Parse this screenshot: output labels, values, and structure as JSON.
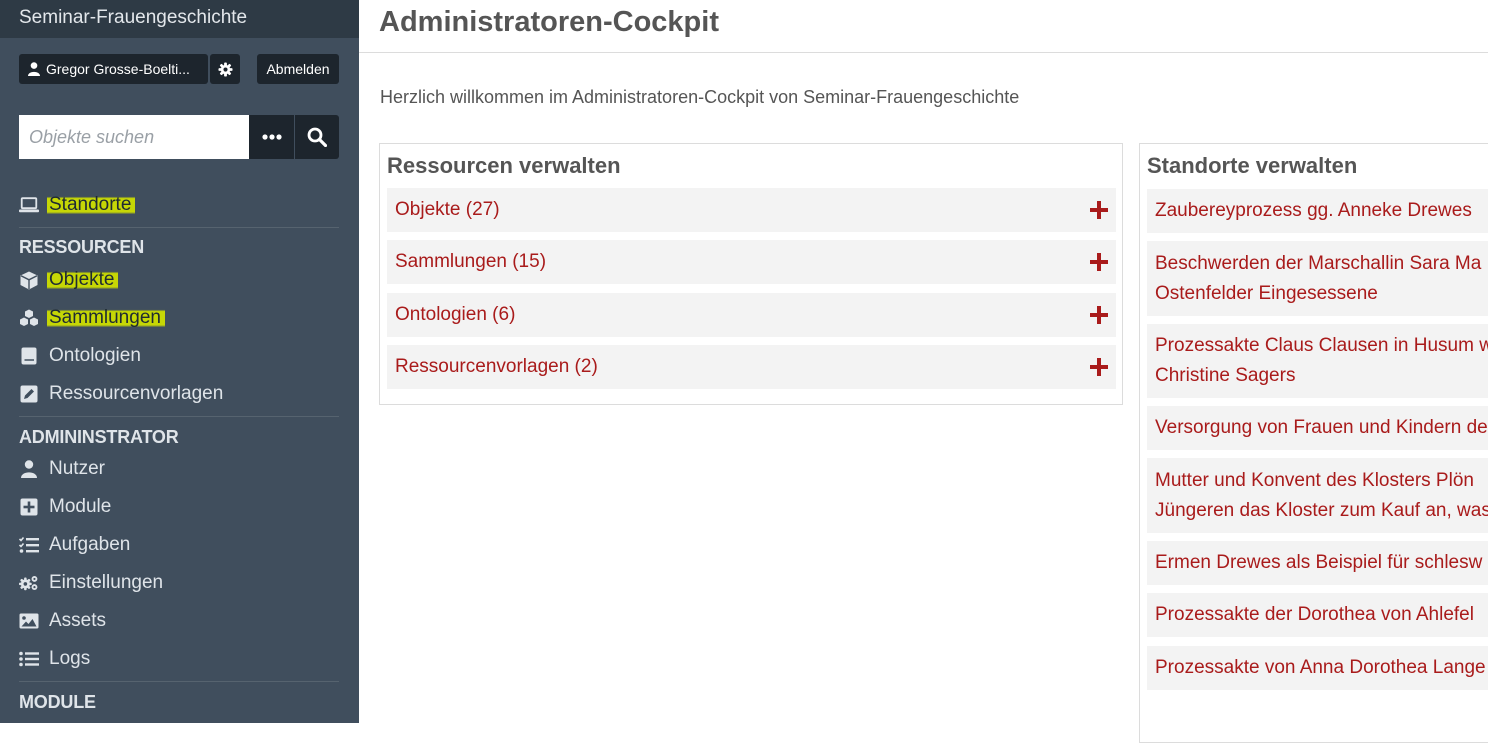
{
  "site": {
    "title": "Seminar-Frauengeschichte"
  },
  "user": {
    "name": "Gregor Grosse-Boelti...",
    "logout_label": "Abmelden"
  },
  "search": {
    "placeholder": "Objekte suchen"
  },
  "nav": {
    "top": [
      {
        "label": "Standorte",
        "icon": "laptop-icon",
        "highlighted": true
      }
    ],
    "resources_heading": "RESSOURCEN",
    "resources": [
      {
        "label": "Objekte",
        "icon": "cube-icon",
        "highlighted": true
      },
      {
        "label": "Sammlungen",
        "icon": "cubes-icon",
        "highlighted": true
      },
      {
        "label": "Ontologien",
        "icon": "book-icon",
        "highlighted": false
      },
      {
        "label": "Ressourcenvorlagen",
        "icon": "edit-icon",
        "highlighted": false
      }
    ],
    "admin_heading": "ADMININSTRATOR",
    "admin": [
      {
        "label": "Nutzer",
        "icon": "user-icon"
      },
      {
        "label": "Module",
        "icon": "plus-square-icon"
      },
      {
        "label": "Aufgaben",
        "icon": "tasks-icon"
      },
      {
        "label": "Einstellungen",
        "icon": "cogs-icon"
      },
      {
        "label": "Assets",
        "icon": "image-icon"
      },
      {
        "label": "Logs",
        "icon": "list-icon"
      }
    ],
    "modules_heading": "MODULE"
  },
  "page": {
    "title": "Administratoren-Cockpit",
    "welcome": "Herzlich willkommen im Administratoren-Cockpit von Seminar-Frauengeschichte"
  },
  "resources_panel": {
    "title": "Ressourcen verwalten",
    "items": [
      {
        "label": "Objekte (27)"
      },
      {
        "label": "Sammlungen (15)"
      },
      {
        "label": "Ontologien (6)"
      },
      {
        "label": "Ressourcenvorlagen (2)"
      }
    ]
  },
  "sites_panel": {
    "title": "Standorte verwalten",
    "items": [
      {
        "line1": "Zaubereyprozess gg. Anneke Drewes",
        "line2": ""
      },
      {
        "line1": "Beschwerden der Marschallin Sara Ma",
        "line2": "Ostenfelder Eingesessene"
      },
      {
        "line1": "Prozessakte Claus Clausen in Husum w",
        "line2": "Christine Sagers"
      },
      {
        "line1": "Versorgung von Frauen und Kindern de",
        "line2": ""
      },
      {
        "line1": "Mutter und Konvent des Klosters Plön",
        "line2": "Jüngeren das Kloster zum Kauf an, was"
      },
      {
        "line1": "Ermen Drewes als Beispiel für schlesw",
        "line2": ""
      },
      {
        "line1": "Prozessakte der Dorothea von Ahlefel",
        "line2": ""
      },
      {
        "line1": "Prozessakte von Anna Dorothea Lange",
        "line2": ""
      }
    ]
  },
  "colors": {
    "sidebar": "#404e5d",
    "link": "#a91b1b",
    "highlight": "#cdde00"
  }
}
